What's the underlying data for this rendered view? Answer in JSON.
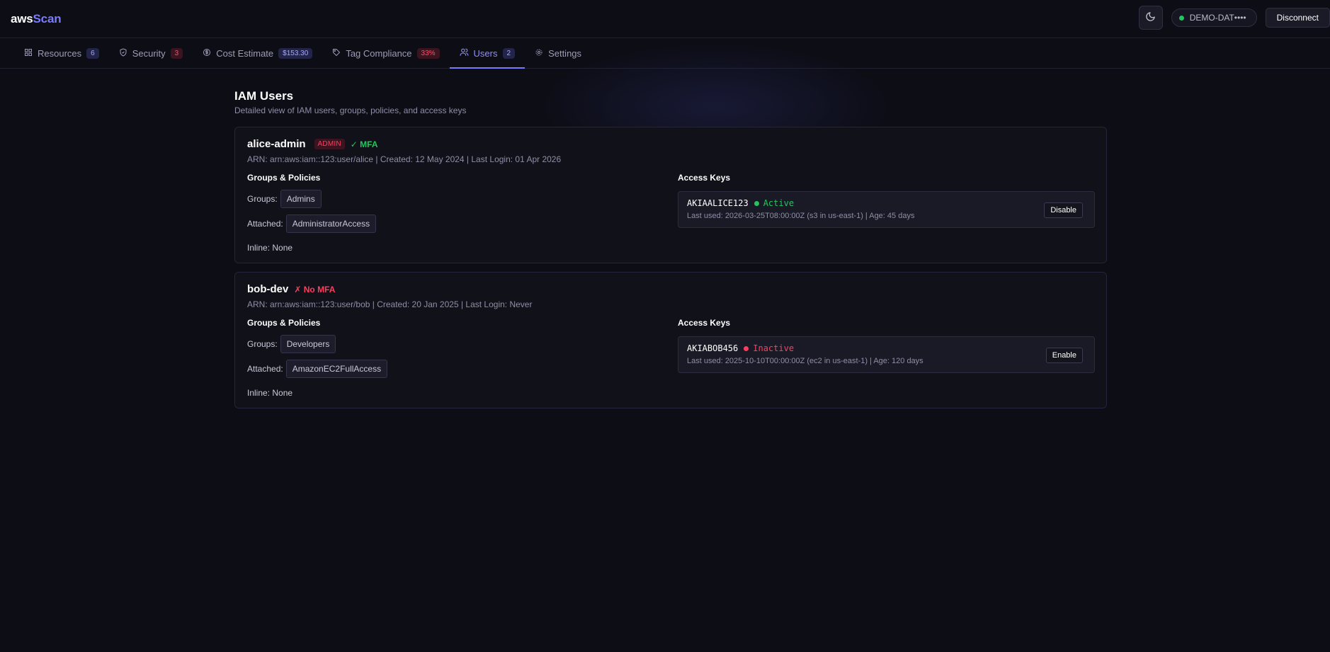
{
  "app": {
    "logo_aws": "aws",
    "logo_scan": "Scan"
  },
  "header": {
    "theme_icon": "moon-icon",
    "connection_label": "DEMO-DAT••••",
    "connection_color": "#22c55e",
    "disconnect_label": "Disconnect"
  },
  "tabs": [
    {
      "label": "Resources",
      "badge": "6",
      "icon": "grid-icon"
    },
    {
      "label": "Security",
      "badge": "3",
      "icon": "shield-icon"
    },
    {
      "label": "Cost Estimate",
      "badge": "$153.30",
      "icon": "dollar-icon"
    },
    {
      "label": "Tag Compliance",
      "badge": "33%",
      "icon": "tag-icon"
    },
    {
      "label": "Users",
      "badge": "2",
      "icon": "users-icon",
      "active": true
    },
    {
      "label": "Settings",
      "icon": "gear-icon"
    }
  ],
  "page": {
    "title": "IAM Users",
    "subtitle": "Detailed view of IAM users, groups, policies, and access keys"
  },
  "labels": {
    "groups_policies": "Groups & Policies",
    "access_keys": "Access Keys",
    "groups": "Groups:",
    "attached": "Attached:"
  },
  "users": [
    {
      "name": "alice-admin",
      "admin_tag": "ADMIN",
      "mfa": "✓ MFA",
      "meta": "ARN: arn:aws:iam::123:user/alice | Created: 12 May 2024 | Last Login: 01 Apr 2026",
      "group": "Admins",
      "attached": "AdministratorAccess",
      "inline": "Inline: None",
      "key": {
        "id": "AKIAALICE123",
        "status": "Active",
        "last_used": "Last used: 2026-03-25T08:00:00Z (s3 in us-east-1) | Age: 45 days",
        "action": "Disable"
      }
    },
    {
      "name": "bob-dev",
      "mfa": "✗ No MFA",
      "meta": "ARN: arn:aws:iam::123:user/bob | Created: 20 Jan 2025 | Last Login: Never",
      "group": "Developers",
      "attached": "AmazonEC2FullAccess",
      "inline": "Inline: None",
      "key": {
        "id": "AKIABOB456",
        "status": "Inactive",
        "last_used": "Last used: 2025-10-10T00:00:00Z (ec2 in us-east-1) | Age: 120 days",
        "action": "Enable"
      }
    }
  ],
  "colors": {
    "accent": "#7b7bff",
    "success": "#22c55e",
    "danger": "#ff3d5e",
    "background": "#0d0d16"
  }
}
